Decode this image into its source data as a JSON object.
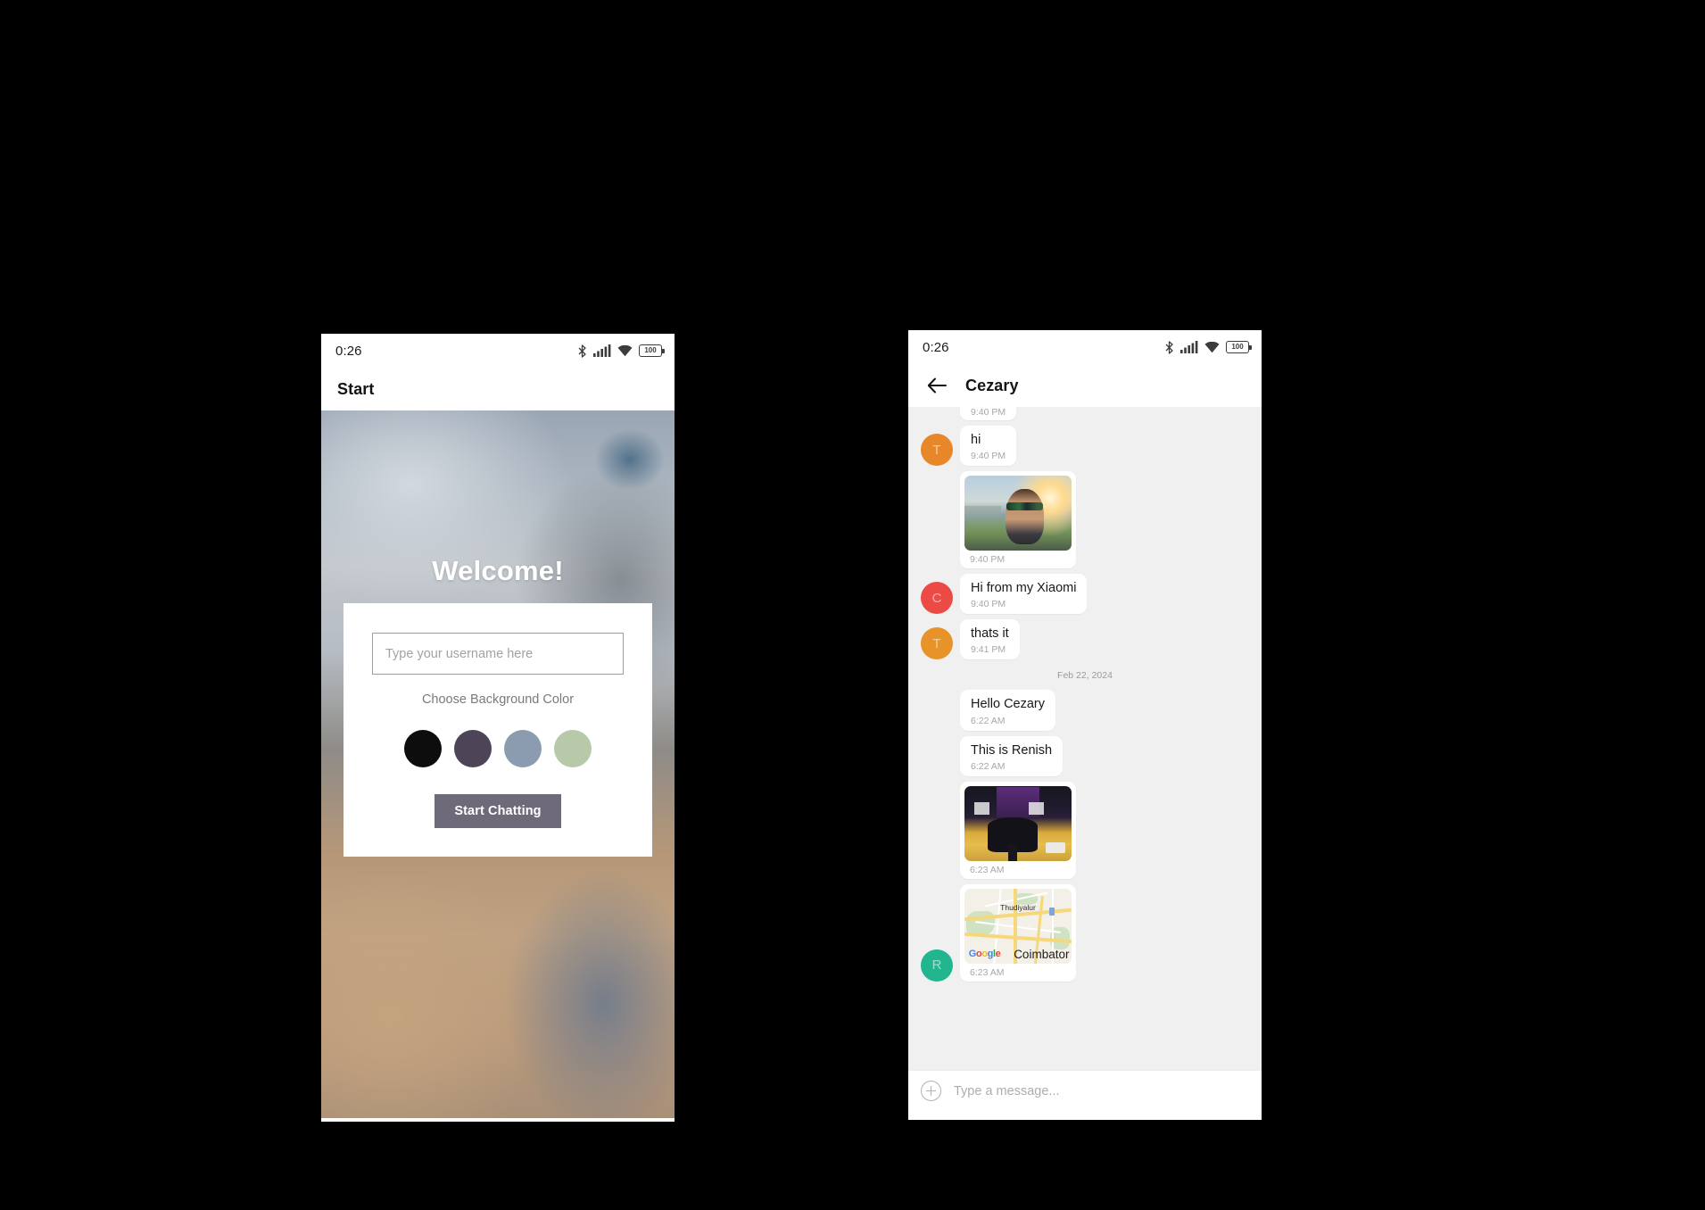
{
  "status_bar": {
    "time": "0:26",
    "battery_label": "100",
    "icons": [
      "bluetooth-icon",
      "cellular-signal-icon",
      "wifi-icon",
      "battery-icon"
    ]
  },
  "start_screen": {
    "app_bar": {
      "title": "Start"
    },
    "welcome_heading": "Welcome!",
    "username_input": {
      "value": "",
      "placeholder": "Type your username here"
    },
    "choose_color_label": "Choose Background Color",
    "color_swatches": [
      {
        "name": "black",
        "hex": "#0d0d0d"
      },
      {
        "name": "dark-purple",
        "hex": "#4e4458"
      },
      {
        "name": "blue-gray",
        "hex": "#8b9cb0"
      },
      {
        "name": "sage-green",
        "hex": "#b7c9a8"
      }
    ],
    "start_button": {
      "label": "Start Chatting",
      "hex": "#6e6a79"
    }
  },
  "chat_screen": {
    "app_bar": {
      "title": "Cezary",
      "back_icon": "back-arrow-icon"
    },
    "messages": [
      {
        "kind": "clipped",
        "time": "9:40 PM",
        "avatar": null
      },
      {
        "kind": "text",
        "text": "hi",
        "time": "9:40 PM",
        "avatar": {
          "initial": "T",
          "hex": "#e8862a"
        }
      },
      {
        "kind": "photo",
        "photo": "selfie-sunset-photo",
        "time": "9:40 PM",
        "avatar": null
      },
      {
        "kind": "text",
        "text": "Hi from my Xiaomi",
        "time": "9:40 PM",
        "avatar": {
          "initial": "C",
          "hex": "#ec4a44"
        }
      },
      {
        "kind": "text",
        "text": "thats it",
        "time": "9:41 PM",
        "avatar": {
          "initial": "T",
          "hex": "#e8922a"
        }
      },
      {
        "kind": "divider",
        "label": "Feb 22, 2024"
      },
      {
        "kind": "text",
        "text": "Hello Cezary",
        "time": "6:22 AM",
        "avatar": null
      },
      {
        "kind": "text",
        "text": "This is Renish",
        "time": "6:22 AM",
        "avatar": null
      },
      {
        "kind": "photo",
        "photo": "dark-object-room-photo",
        "time": "6:23 AM",
        "avatar": null
      },
      {
        "kind": "map",
        "map_town": "Thudiyalur",
        "map_city": "Coimbator",
        "map_watermark": "Google",
        "time": "6:23 AM",
        "avatar": {
          "initial": "R",
          "hex": "#21b68d"
        }
      }
    ],
    "composer": {
      "placeholder": "Type a message...",
      "value": "",
      "add_icon": "plus-circle-icon"
    }
  },
  "nav_bar": {
    "recents_icon": "square-recents-icon",
    "home_icon": "circle-home-icon",
    "back_icon": "triangle-back-icon"
  }
}
